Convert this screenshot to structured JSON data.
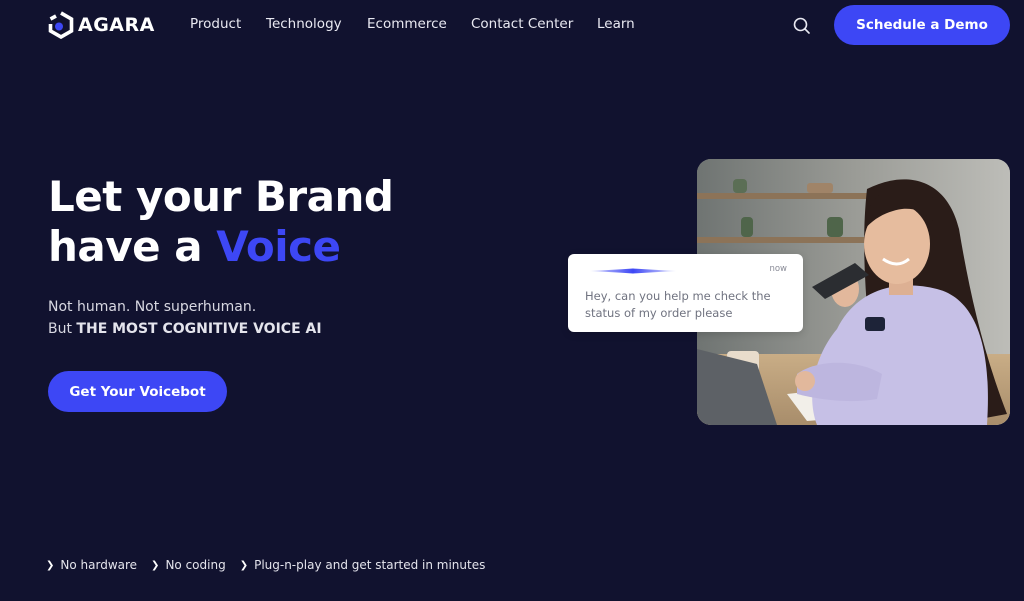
{
  "brand": {
    "name": "AGARA",
    "logo_icon": "hexagon-logo-icon",
    "accent_color": "#3d47f5",
    "background_color": "#11122f"
  },
  "nav": {
    "items": [
      {
        "label": "Product"
      },
      {
        "label": "Technology"
      },
      {
        "label": "Ecommerce"
      },
      {
        "label": "Contact Center"
      },
      {
        "label": "Learn"
      }
    ],
    "search_icon": "search-icon",
    "cta_label": "Schedule a Demo"
  },
  "hero": {
    "title_line1": "Let your Brand",
    "title_line2_prefix": "have a ",
    "title_line2_accent": "Voice",
    "subtitle_line1": "Not human. Not superhuman.",
    "subtitle_line2_prefix": "But ",
    "subtitle_line2_bold": "THE MOST COGNITIVE VOICE AI",
    "cta_label": "Get Your Voicebot"
  },
  "chat_bubble": {
    "wave_icon": "voice-waveform-icon",
    "time": "now",
    "message": "Hey, can you help me check the status of my order please"
  },
  "photo": {
    "alt": "Smiling woman speaking into a smartphone at a desk with laptop"
  },
  "features": [
    {
      "icon": "chevron-right-icon",
      "label": "No hardware"
    },
    {
      "icon": "chevron-right-icon",
      "label": "No coding"
    },
    {
      "icon": "chevron-right-icon",
      "label": "Plug-n-play and get started in minutes"
    }
  ]
}
